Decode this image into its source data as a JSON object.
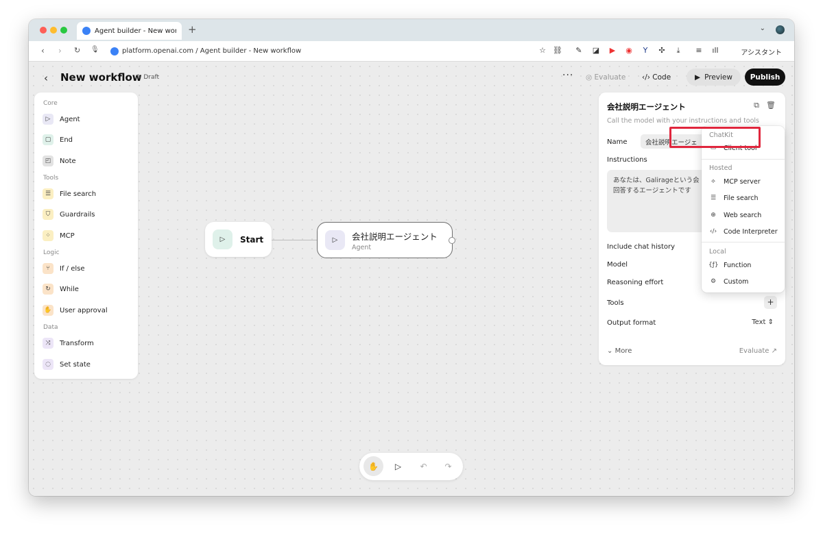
{
  "browser": {
    "tab_title": "Agent builder - New workflo",
    "new_tab": "+",
    "url": "platform.openai.com / Agent builder - New workflow",
    "assistant_label": "アシスタント"
  },
  "header": {
    "title": "New workflow",
    "draft": "Draft",
    "more": "···",
    "evaluate": "Evaluate",
    "code": "Code",
    "preview": "Preview",
    "publish": "Publish"
  },
  "palette": {
    "sections": [
      {
        "title": "Core",
        "items": [
          {
            "label": "Agent",
            "icon": "agent-icon"
          },
          {
            "label": "End",
            "icon": "end-icon"
          },
          {
            "label": "Note",
            "icon": "note-icon"
          }
        ]
      },
      {
        "title": "Tools",
        "items": [
          {
            "label": "File search",
            "icon": "database-icon"
          },
          {
            "label": "Guardrails",
            "icon": "shield-icon"
          },
          {
            "label": "MCP",
            "icon": "mcp-icon"
          }
        ]
      },
      {
        "title": "Logic",
        "items": [
          {
            "label": "If / else",
            "icon": "branch-icon"
          },
          {
            "label": "While",
            "icon": "loop-icon"
          },
          {
            "label": "User approval",
            "icon": "hand-icon"
          }
        ]
      },
      {
        "title": "Data",
        "items": [
          {
            "label": "Transform",
            "icon": "shuffle-icon"
          },
          {
            "label": "Set state",
            "icon": "state-icon"
          }
        ]
      }
    ]
  },
  "canvas": {
    "start_node": "Start",
    "agent_node": {
      "title": "会社説明エージェント",
      "subtitle": "Agent"
    }
  },
  "inspector": {
    "title": "会社説明エージェント",
    "description": "Call the model with your instructions and tools",
    "name_label": "Name",
    "name_value": "会社説明エージェ",
    "instructions_label": "Instructions",
    "instructions_line1": "あなたは、Galirageという会",
    "instructions_line2": "回答するエージェントです",
    "include_chat_history": "Include chat history",
    "model": "Model",
    "reasoning_effort": "Reasoning effort",
    "tools": "Tools",
    "tools_add": "+",
    "output_format": "Output format",
    "output_format_value": "Text",
    "more": "More",
    "evaluate": "Evaluate"
  },
  "dropdown": {
    "sections": [
      {
        "title": "ChatKit",
        "items": [
          {
            "label": "Client tool",
            "icon": "chat-icon"
          }
        ]
      },
      {
        "title": "Hosted",
        "items": [
          {
            "label": "MCP server",
            "icon": "server-icon"
          },
          {
            "label": "File search",
            "icon": "database-icon"
          },
          {
            "label": "Web search",
            "icon": "globe-icon"
          },
          {
            "label": "Code Interpreter",
            "icon": "code-icon"
          }
        ]
      },
      {
        "title": "Local",
        "items": [
          {
            "label": "Function",
            "icon": "function-icon"
          },
          {
            "label": "Custom",
            "icon": "gear-icon"
          }
        ]
      }
    ],
    "highlighted": "File search"
  },
  "colors": {
    "publish_bg": "#111111",
    "highlight_border": "#e0263d"
  }
}
